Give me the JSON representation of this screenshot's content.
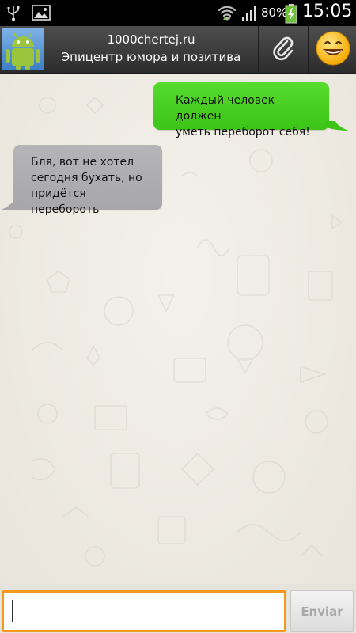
{
  "status_bar": {
    "battery_percent": "80%",
    "time": "15:05",
    "icons": [
      "usb-icon",
      "gallery-icon",
      "wifi-icon",
      "signal-icon",
      "battery-charging-icon"
    ]
  },
  "header": {
    "title": "1000chertej.ru",
    "subtitle": "Эпицентр юмора и позитива",
    "avatar_icon": "android-robot-icon",
    "attach_icon": "paperclip-icon",
    "emoji_icon": "smiley-emoji-icon"
  },
  "messages": [
    {
      "direction": "outgoing",
      "color": "#4cd122",
      "lines": [
        "Каждый человек должен",
        "уметь переборот себя!"
      ]
    },
    {
      "direction": "incoming",
      "color": "#afafb1",
      "lines": [
        "Бля, вот не хотел",
        "сегодня бухать, но",
        "придётся перебороть"
      ]
    }
  ],
  "composer": {
    "input_value": "",
    "send_label": "Enviar",
    "accent_color": "#f39a1e"
  }
}
